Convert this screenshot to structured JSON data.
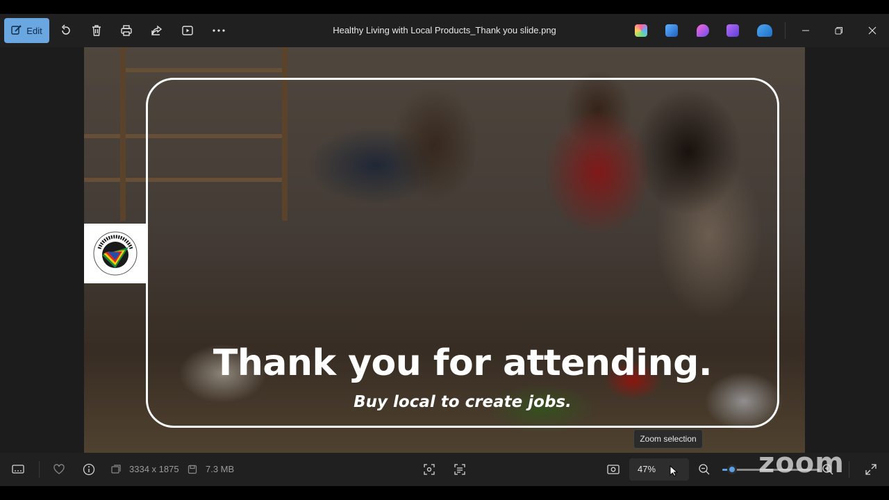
{
  "window": {
    "title": "Healthy Living with Local Products_Thank you slide.png",
    "edit_label": "Edit"
  },
  "toolbar": {
    "icons": [
      "rotate-icon",
      "delete-icon",
      "print-icon",
      "share-icon",
      "slideshow-icon",
      "more-icon"
    ],
    "app_icons": [
      "copilot-icon",
      "designer-icon",
      "clipchamp-icon",
      "create-icon",
      "onedrive-icon"
    ],
    "app_colors": [
      "#5fb3ff",
      "#3a8dde",
      "#c94fd8",
      "#8a5cf0",
      "#3a8dde"
    ]
  },
  "slide": {
    "headline": "Thank you for attending.",
    "tagline": "Buy local to create jobs.",
    "logo_text": "PROUDLY SOUTH AFRICAN"
  },
  "tooltip": {
    "text": "Zoom selection"
  },
  "statusbar": {
    "dimensions": "3334 x 1875",
    "file_size": "7.3 MB",
    "zoom": "47%",
    "zoom_fraction": 0.1,
    "watermark": "zoom"
  }
}
